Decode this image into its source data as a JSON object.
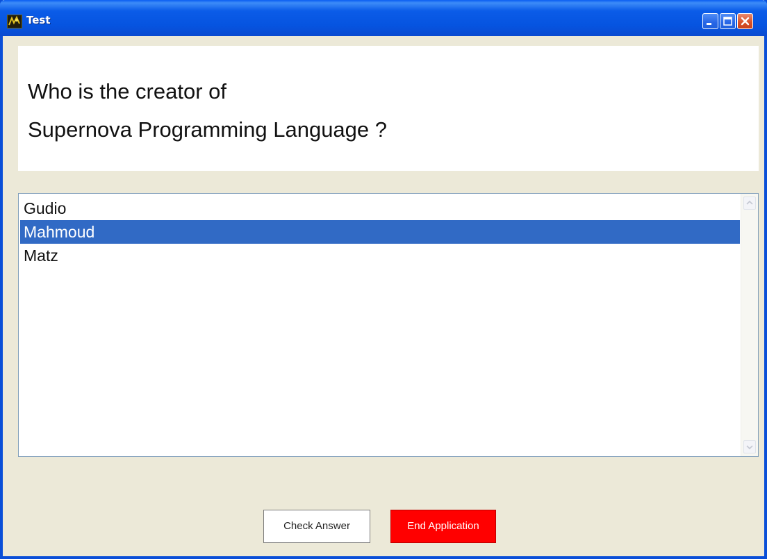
{
  "window": {
    "title": "Test"
  },
  "question": {
    "line1": "Who is the creator of",
    "line2": "Supernova Programming Language ?"
  },
  "answers": {
    "items": [
      {
        "label": "Gudio",
        "selected": false
      },
      {
        "label": "Mahmoud",
        "selected": true
      },
      {
        "label": "Matz",
        "selected": false
      }
    ]
  },
  "buttons": {
    "check_answer": "Check Answer",
    "end_application": "End Application"
  },
  "colors": {
    "title_bar": "#0a5ce8",
    "selection": "#316ac5",
    "end_button": "#ff0000",
    "window_face": "#ece9d8"
  },
  "icons": {
    "app": "app-icon",
    "minimize": "minimize-icon",
    "maximize": "maximize-icon",
    "close": "close-icon",
    "scroll_up": "scroll-up-arrow-icon",
    "scroll_down": "scroll-down-arrow-icon"
  }
}
